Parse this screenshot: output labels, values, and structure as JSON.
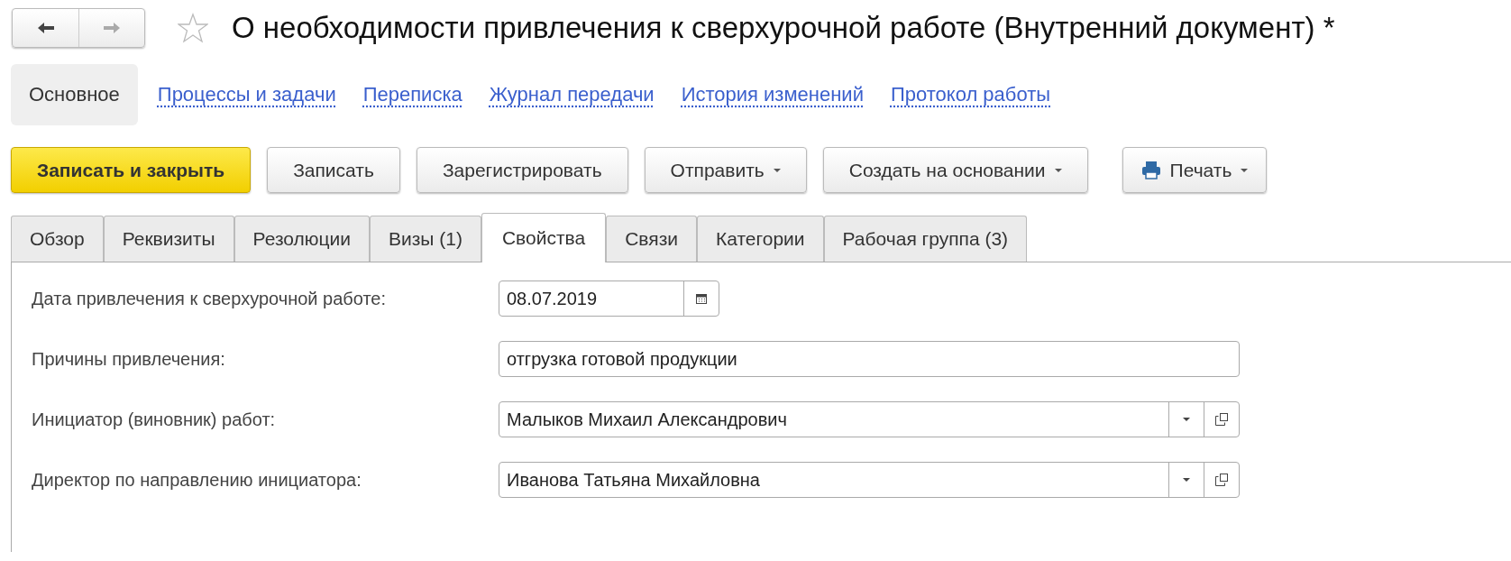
{
  "navigation": [
    {
      "kind": "back",
      "disabled": false
    },
    {
      "kind": "forward",
      "disabled": true
    }
  ],
  "favorite": false,
  "title": "О необходимости привлечения к сверхурочной работе (Внутренний документ) *",
  "sections": [
    {
      "label": "Основное",
      "selected": true
    },
    {
      "label": "Процессы и задачи",
      "selected": false
    },
    {
      "label": "Переписка",
      "selected": false
    },
    {
      "label": "Журнал передачи",
      "selected": false
    },
    {
      "label": "История изменений",
      "selected": false
    },
    {
      "label": "Протокол работы",
      "selected": false
    }
  ],
  "commands": [
    {
      "label": "Записать и закрыть",
      "kind": "primary",
      "dropdown": false
    },
    {
      "label": "Записать",
      "kind": "default",
      "dropdown": false
    },
    {
      "label": "Зарегистрировать",
      "kind": "default",
      "dropdown": false
    },
    {
      "label": "Отправить",
      "kind": "default",
      "dropdown": true
    },
    {
      "label": "Создать на основании",
      "kind": "default",
      "dropdown": true
    },
    {
      "label": "Печать",
      "kind": "print",
      "dropdown": true
    }
  ],
  "tabs": [
    {
      "label": "Обзор",
      "selected": false
    },
    {
      "label": "Реквизиты",
      "selected": false
    },
    {
      "label": "Резолюции",
      "selected": false
    },
    {
      "label": "Визы (1)",
      "selected": false
    },
    {
      "label": "Свойства",
      "selected": true
    },
    {
      "label": "Связи",
      "selected": false
    },
    {
      "label": "Категории",
      "selected": false
    },
    {
      "label": "Рабочая группа (3)",
      "selected": false
    }
  ],
  "fields": [
    {
      "label": "Дата привлечения к сверхурочной работе:",
      "kind": "date",
      "value": "08.07.2019"
    },
    {
      "label": "Причины привлечения:",
      "kind": "text",
      "value": "отгрузка готовой продукции"
    },
    {
      "label": "Инициатор (виновник) работ:",
      "kind": "reference",
      "value": "Малыков Михаил Александрович"
    },
    {
      "label": "Директор по направлению инициатора:",
      "kind": "reference",
      "value": "Иванова Татьяна Михайловна"
    }
  ]
}
